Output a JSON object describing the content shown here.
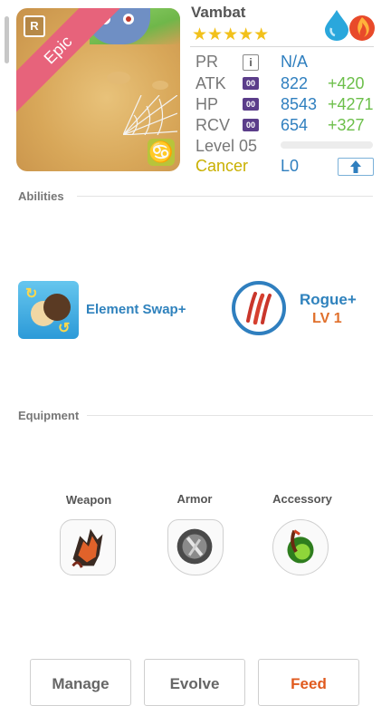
{
  "monster": {
    "name": "Vambat",
    "rarity": "Epic",
    "frame_letter": "R",
    "stars": "★★★★★",
    "elements": [
      "water-drop-icon",
      "fire-icon"
    ],
    "zodiac_symbol": "♋"
  },
  "stats": {
    "pr": {
      "label": "PR",
      "icon": "i",
      "value": "N/A"
    },
    "atk": {
      "label": "ATK",
      "icon": "00",
      "value": "822",
      "bonus": "+420"
    },
    "hp": {
      "label": "HP",
      "icon": "00",
      "value": "8543",
      "bonus": "+4271"
    },
    "rcv": {
      "label": "RCV",
      "icon": "00",
      "value": "654",
      "bonus": "+327"
    },
    "level": "Level 05",
    "level_progress": 0.0,
    "zodiac": "Cancer",
    "limit": "L0"
  },
  "abilities": {
    "title": "Abilities",
    "items": [
      {
        "name": "Element Swap+"
      },
      {
        "name": "Rogue+",
        "level": "LV 1"
      }
    ]
  },
  "equipment": {
    "title": "Equipment",
    "slots": [
      {
        "label": "Weapon"
      },
      {
        "label": "Armor"
      },
      {
        "label": "Accessory"
      }
    ]
  },
  "actions": {
    "manage": "Manage",
    "evolve": "Evolve",
    "feed": "Feed"
  },
  "colors": {
    "accent_blue": "#2f7fbf",
    "bonus_green": "#6cbf4a",
    "feed_orange": "#e05a1e",
    "zodiac_yellow": "#c9b000",
    "rarity_pink": "#e7637b"
  }
}
